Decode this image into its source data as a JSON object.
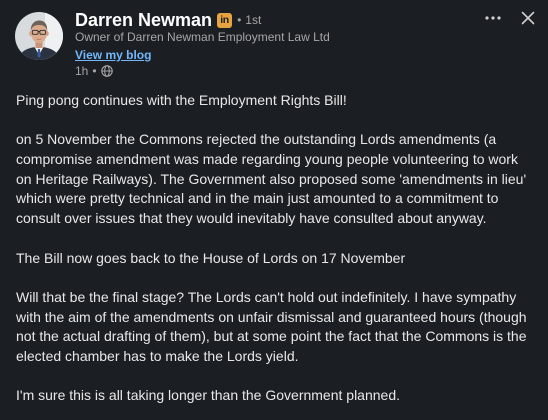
{
  "author": {
    "name": "Darren Newman",
    "badge_text": "in",
    "separator": "•",
    "connection_degree": "1st",
    "headline": "Owner of Darren Newman Employment Law Ltd",
    "link_label": "View my blog",
    "timestamp": "1h",
    "meta_separator": "•"
  },
  "icons": {
    "avatar": "profile-photo",
    "badge": "linkedin-premium-icon",
    "visibility": "globe-icon",
    "more": "more-horizontal-icon",
    "close": "close-icon"
  },
  "colors": {
    "background": "#1b1f23",
    "body_text": "#e8e8e8",
    "secondary_text": "#a6a6a6",
    "link": "#71b7fb",
    "badge": "#e7a33e"
  },
  "post": {
    "paragraphs": [
      [
        "Ping pong continues with the Employment Rights Bill!"
      ],
      [
        "on 5 November the Commons rejected the outstanding Lords amendments (a",
        "compromise amendment was made regarding young people volunteering to work",
        "on Heritage Railways). The Government also proposed some 'amendments in lieu'",
        "which were pretty technical and in the main just amounted to a commitment to",
        "consult over issues that they would inevitably have consulted about anyway."
      ],
      [
        "The Bill now goes back to the House of Lords on 17 November"
      ],
      [
        "Will that be the final stage? The Lords can't hold out indefinitely. I have sympathy",
        "with the aim of the amendments on unfair dismissal and guaranteed hours (though",
        "not the actual drafting of them), but at some point the fact that the Commons is the",
        "elected chamber has to make the Lords yield."
      ],
      [
        "I'm sure this is all taking longer than the Government planned."
      ]
    ]
  }
}
